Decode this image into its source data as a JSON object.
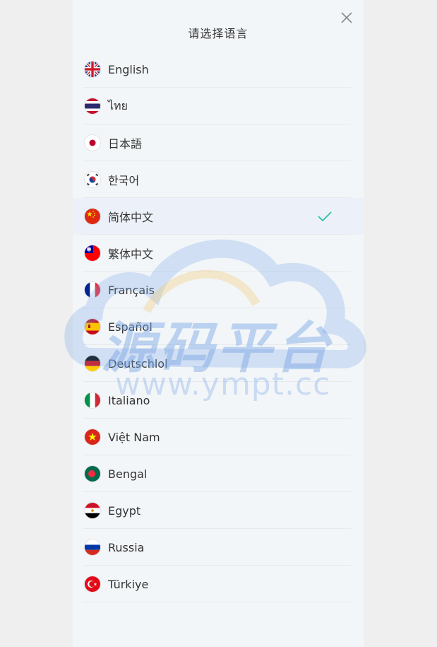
{
  "dialog": {
    "title": "请选择语言"
  },
  "languages": [
    {
      "label": "English",
      "flag": "uk-flag-icon",
      "selected": false
    },
    {
      "label": "ไทย",
      "flag": "thailand-flag-icon",
      "selected": false
    },
    {
      "label": "日本語",
      "flag": "japan-flag-icon",
      "selected": false
    },
    {
      "label": "한국어",
      "flag": "korea-flag-icon",
      "selected": false
    },
    {
      "label": "简体中文",
      "flag": "china-flag-icon",
      "selected": true
    },
    {
      "label": "繁体中文",
      "flag": "taiwan-flag-icon",
      "selected": false
    },
    {
      "label": "Français",
      "flag": "france-flag-icon",
      "selected": false
    },
    {
      "label": "Español",
      "flag": "spain-flag-icon",
      "selected": false
    },
    {
      "label": "Deutschlol",
      "flag": "germany-flag-icon",
      "selected": false
    },
    {
      "label": "Italiano",
      "flag": "italy-flag-icon",
      "selected": false
    },
    {
      "label": "Việt Nam",
      "flag": "vietnam-flag-icon",
      "selected": false
    },
    {
      "label": "Bengal",
      "flag": "bangladesh-flag-icon",
      "selected": false
    },
    {
      "label": "Egypt",
      "flag": "egypt-flag-icon",
      "selected": false
    },
    {
      "label": "Russia",
      "flag": "russia-flag-icon",
      "selected": false
    },
    {
      "label": "Türkiye",
      "flag": "turkey-flag-icon",
      "selected": false
    }
  ],
  "watermark": {
    "brand": "源码平台",
    "url": "www.ympt.cc"
  },
  "colors": {
    "check": "#2bbfa8",
    "selected_bg": "#ecf1f9",
    "panel_bg": "#f3f6f8"
  }
}
